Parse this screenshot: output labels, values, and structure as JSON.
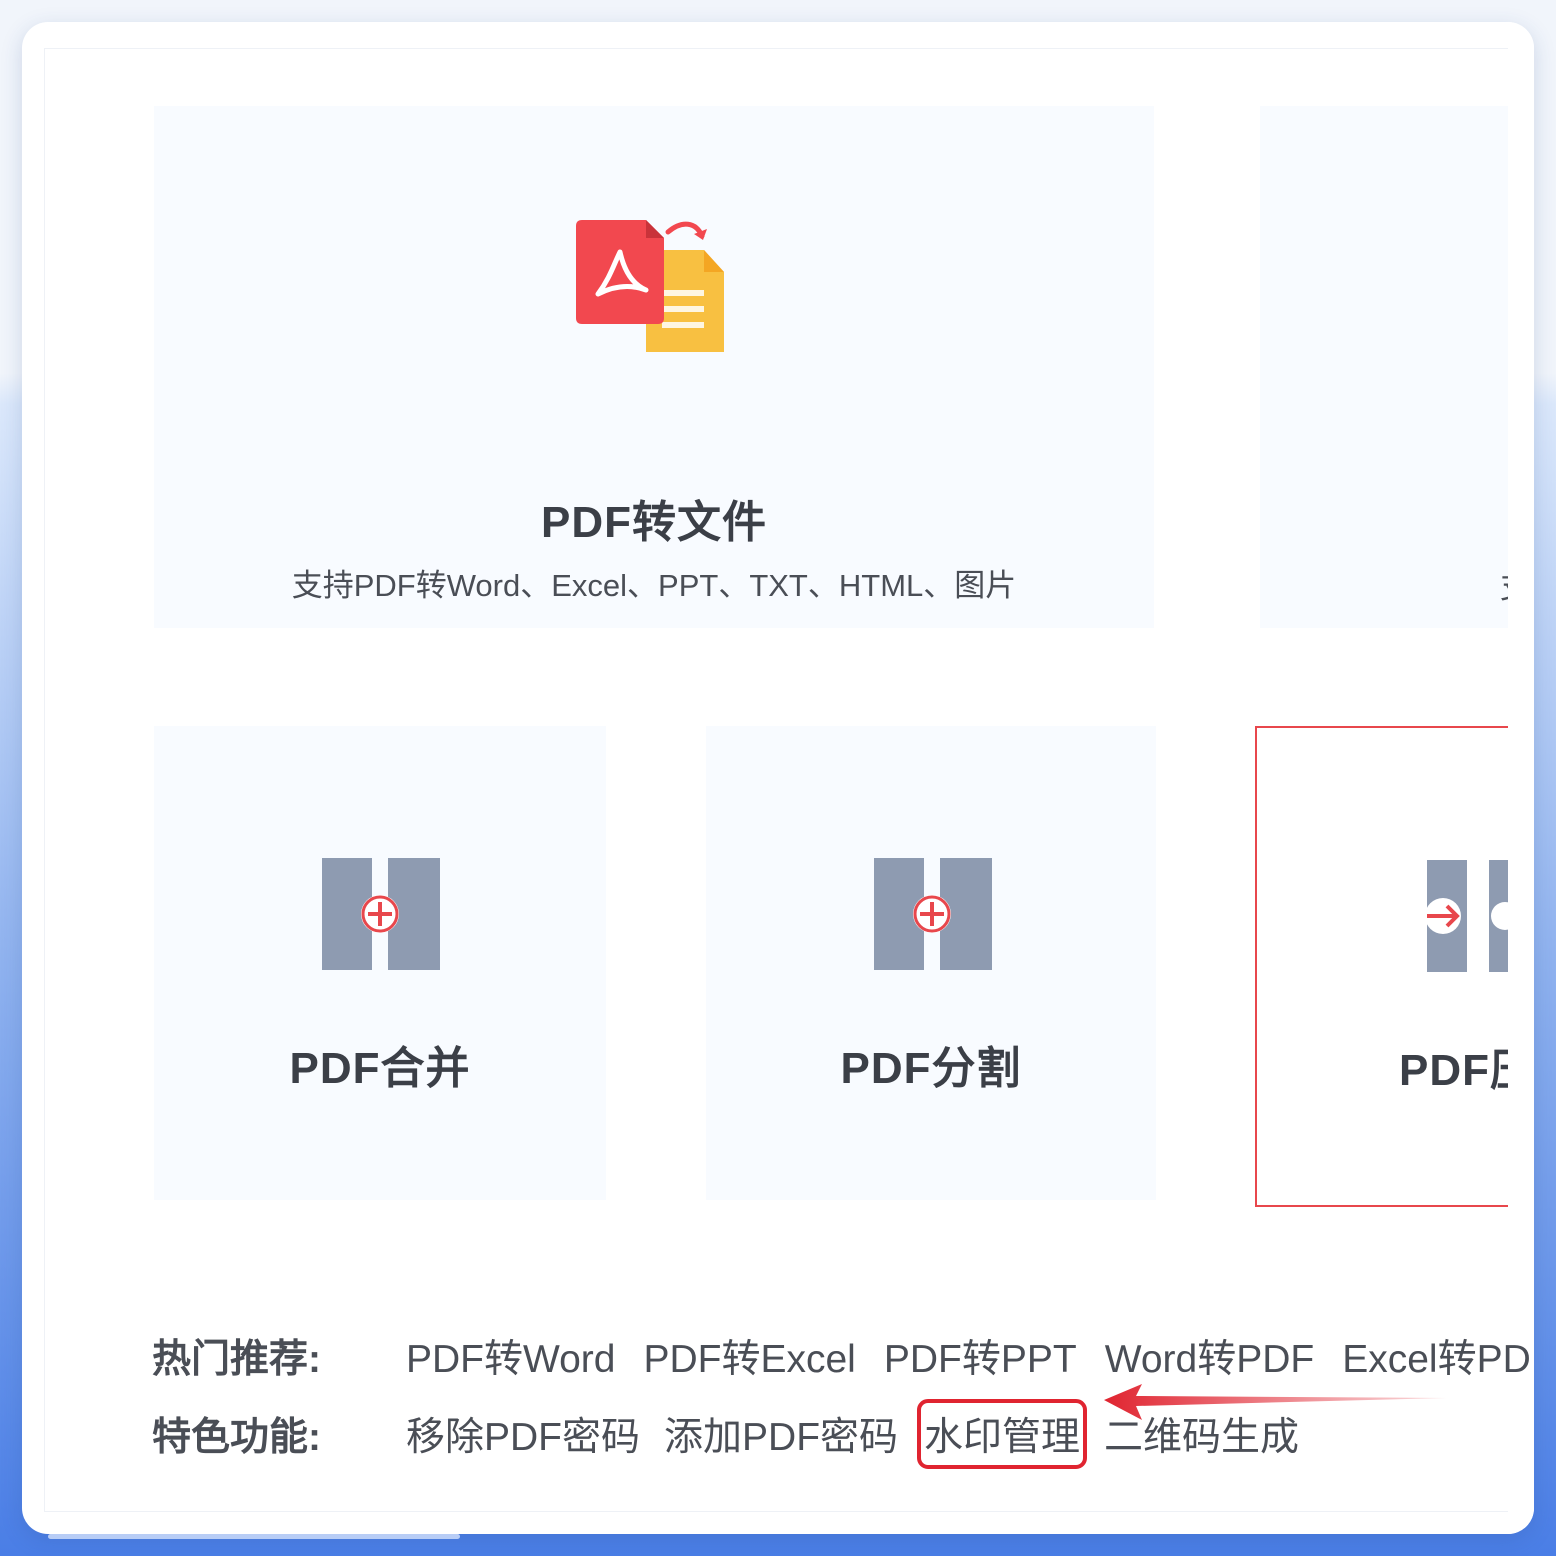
{
  "cards": {
    "pdf_to_file": {
      "title": "PDF转文件",
      "desc": "支持PDF转Word、Excel、PPT、TXT、HTML、图片",
      "icon": "pdf-convert-icon"
    },
    "partial_card_desc": "支",
    "merge": {
      "title": "PDF合并",
      "icon": "pdf-merge-icon"
    },
    "split": {
      "title": "PDF分割",
      "icon": "pdf-split-icon"
    },
    "compress": {
      "title": "PDF压",
      "icon": "pdf-compress-icon"
    }
  },
  "links": {
    "hot_label": "热门推荐:",
    "hot_items": [
      "PDF转Word",
      "PDF转Excel",
      "PDF转PPT",
      "Word转PDF",
      "Excel转PD"
    ],
    "feature_label": "特色功能:",
    "feature_items": [
      "移除PDF密码",
      "添加PDF密码",
      "水印管理",
      "二维码生成"
    ]
  },
  "colors": {
    "highlight_red": "#e02430",
    "icon_gray": "#8e9bb1",
    "pdf_red": "#f2484f",
    "doc_yellow": "#f8c041",
    "card_bg": "#f8fbff"
  }
}
